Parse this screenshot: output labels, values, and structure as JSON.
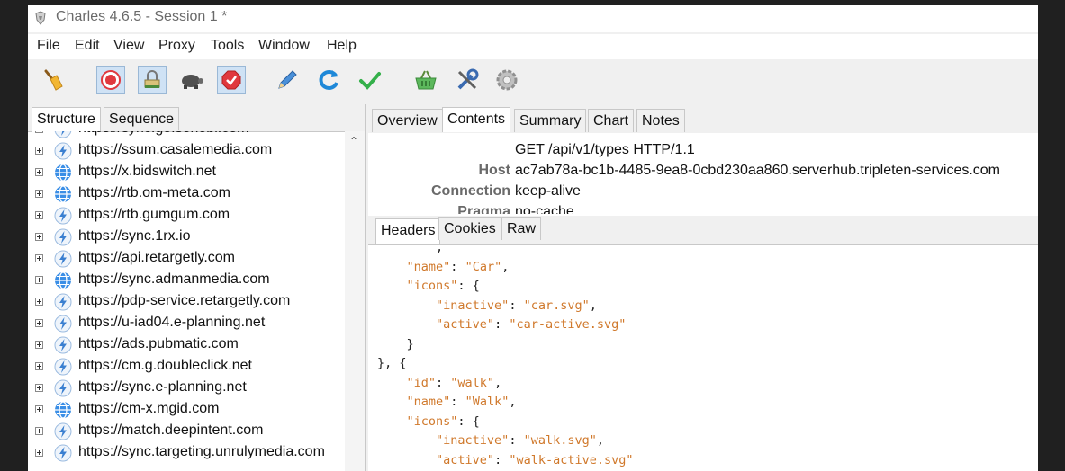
{
  "window": {
    "title": "Charles 4.6.5 - Session 1 *"
  },
  "menu": [
    "File",
    "Edit",
    "View",
    "Proxy",
    "Tools",
    "Window",
    "Help"
  ],
  "toolbar": [
    {
      "name": "broom-icon"
    },
    {
      "name": "record-icon"
    },
    {
      "name": "throttle-icon"
    },
    {
      "name": "turtle-icon"
    },
    {
      "name": "breakpoint-icon"
    },
    {
      "name": "pen-icon"
    },
    {
      "name": "refresh-icon"
    },
    {
      "name": "check-icon"
    },
    {
      "name": "basket-icon"
    },
    {
      "name": "tools-icon"
    },
    {
      "name": "settings-gear-icon"
    }
  ],
  "left_tabs": [
    "Structure",
    "Sequence"
  ],
  "hosts": [
    {
      "label": "https://sync.go.sonobi.com",
      "icon": "bolt"
    },
    {
      "label": "https://ssum.casalemedia.com",
      "icon": "bolt"
    },
    {
      "label": "https://x.bidswitch.net",
      "icon": "globe"
    },
    {
      "label": "https://rtb.om-meta.com",
      "icon": "globe"
    },
    {
      "label": "https://rtb.gumgum.com",
      "icon": "bolt"
    },
    {
      "label": "https://sync.1rx.io",
      "icon": "bolt"
    },
    {
      "label": "https://api.retargetly.com",
      "icon": "bolt"
    },
    {
      "label": "https://sync.admanmedia.com",
      "icon": "globe"
    },
    {
      "label": "https://pdp-service.retargetly.com",
      "icon": "bolt"
    },
    {
      "label": "https://u-iad04.e-planning.net",
      "icon": "bolt"
    },
    {
      "label": "https://ads.pubmatic.com",
      "icon": "bolt"
    },
    {
      "label": "https://cm.g.doubleclick.net",
      "icon": "bolt"
    },
    {
      "label": "https://sync.e-planning.net",
      "icon": "bolt"
    },
    {
      "label": "https://cm-x.mgid.com",
      "icon": "globe"
    },
    {
      "label": "https://match.deepintent.com",
      "icon": "bolt"
    },
    {
      "label": "https://sync.targeting.unrulymedia.com",
      "icon": "bolt"
    }
  ],
  "right_tabs": [
    "Overview",
    "Contents",
    "Summary",
    "Chart",
    "Notes"
  ],
  "request": {
    "request_line": "GET /api/v1/types HTTP/1.1",
    "headers": [
      {
        "key": "Host",
        "value": "ac7ab78a-bc1b-4485-9ea8-0cbd230aa860.serverhub.tripleten-services.com"
      },
      {
        "key": "Connection",
        "value": "keep-alive"
      },
      {
        "key": "Pragma",
        "value": "no-cache"
      }
    ]
  },
  "sub_tabs": [
    "Headers",
    "Cookies",
    "Raw"
  ],
  "code_lines": [
    {
      "indent": "        ",
      "tokens": [
        {
          "t": "p",
          "v": ","
        }
      ]
    },
    {
      "indent": "    ",
      "tokens": [
        {
          "t": "k",
          "v": "\"name\""
        },
        {
          "t": "p",
          "v": ": "
        },
        {
          "t": "s",
          "v": "\"Car\""
        },
        {
          "t": "p",
          "v": ","
        }
      ]
    },
    {
      "indent": "    ",
      "tokens": [
        {
          "t": "k",
          "v": "\"icons\""
        },
        {
          "t": "p",
          "v": ": {"
        }
      ]
    },
    {
      "indent": "        ",
      "tokens": [
        {
          "t": "k",
          "v": "\"inactive\""
        },
        {
          "t": "p",
          "v": ": "
        },
        {
          "t": "s",
          "v": "\"car.svg\""
        },
        {
          "t": "p",
          "v": ","
        }
      ]
    },
    {
      "indent": "        ",
      "tokens": [
        {
          "t": "k",
          "v": "\"active\""
        },
        {
          "t": "p",
          "v": ": "
        },
        {
          "t": "s",
          "v": "\"car-active.svg\""
        }
      ]
    },
    {
      "indent": "    ",
      "tokens": [
        {
          "t": "p",
          "v": "}"
        }
      ]
    },
    {
      "indent": "",
      "tokens": [
        {
          "t": "p",
          "v": "}, {"
        }
      ]
    },
    {
      "indent": "    ",
      "tokens": [
        {
          "t": "k",
          "v": "\"id\""
        },
        {
          "t": "p",
          "v": ": "
        },
        {
          "t": "s",
          "v": "\"walk\""
        },
        {
          "t": "p",
          "v": ","
        }
      ]
    },
    {
      "indent": "    ",
      "tokens": [
        {
          "t": "k",
          "v": "\"name\""
        },
        {
          "t": "p",
          "v": ": "
        },
        {
          "t": "s",
          "v": "\"Walk\""
        },
        {
          "t": "p",
          "v": ","
        }
      ]
    },
    {
      "indent": "    ",
      "tokens": [
        {
          "t": "k",
          "v": "\"icons\""
        },
        {
          "t": "p",
          "v": ": {"
        }
      ]
    },
    {
      "indent": "        ",
      "tokens": [
        {
          "t": "k",
          "v": "\"inactive\""
        },
        {
          "t": "p",
          "v": ": "
        },
        {
          "t": "s",
          "v": "\"walk.svg\""
        },
        {
          "t": "p",
          "v": ","
        }
      ]
    },
    {
      "indent": "        ",
      "tokens": [
        {
          "t": "k",
          "v": "\"active\""
        },
        {
          "t": "p",
          "v": ": "
        },
        {
          "t": "s",
          "v": "\"walk-active.svg\""
        }
      ]
    }
  ]
}
